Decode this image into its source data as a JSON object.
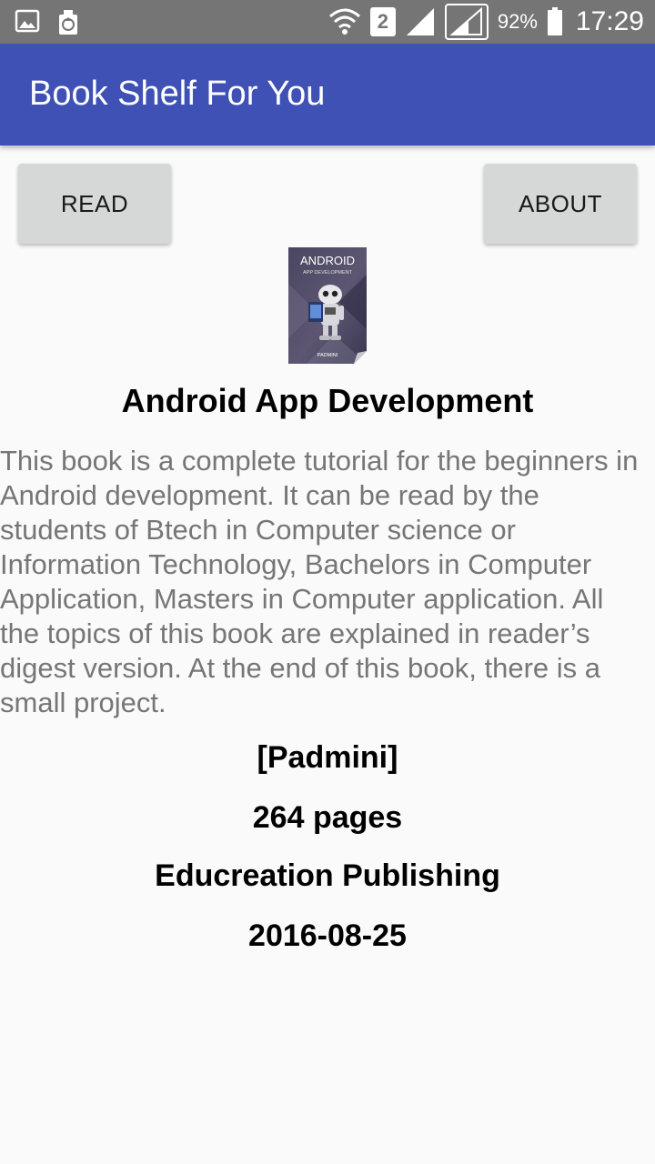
{
  "status_bar": {
    "sim_slot": "2",
    "battery_percent": "92%",
    "time": "17:29"
  },
  "app_bar": {
    "title": "Book Shelf For You"
  },
  "buttons": {
    "read_label": "READ",
    "about_label": "ABOUT"
  },
  "book": {
    "cover": {
      "title_line1": "ANDROID",
      "title_line2": "APP DEVELOPMENT",
      "author": "PADMINI"
    },
    "title": "Android App Development",
    "description": "This book is a complete tutorial for the beginners in Android development. It can be read by the students of Btech in Computer science or Information Technology, Bachelors in Computer Application, Masters in Computer application. All the topics of this book are explained in reader’s digest version. At the end of this book, there is a small project.",
    "author": "[Padmini]",
    "pages": "264 pages",
    "publisher": "Educreation Publishing",
    "published_date": "2016-08-25"
  },
  "colors": {
    "app_bar": "#3f51b5",
    "status_bar": "#757575",
    "button": "#d6d7d7",
    "description_text": "#767676"
  }
}
